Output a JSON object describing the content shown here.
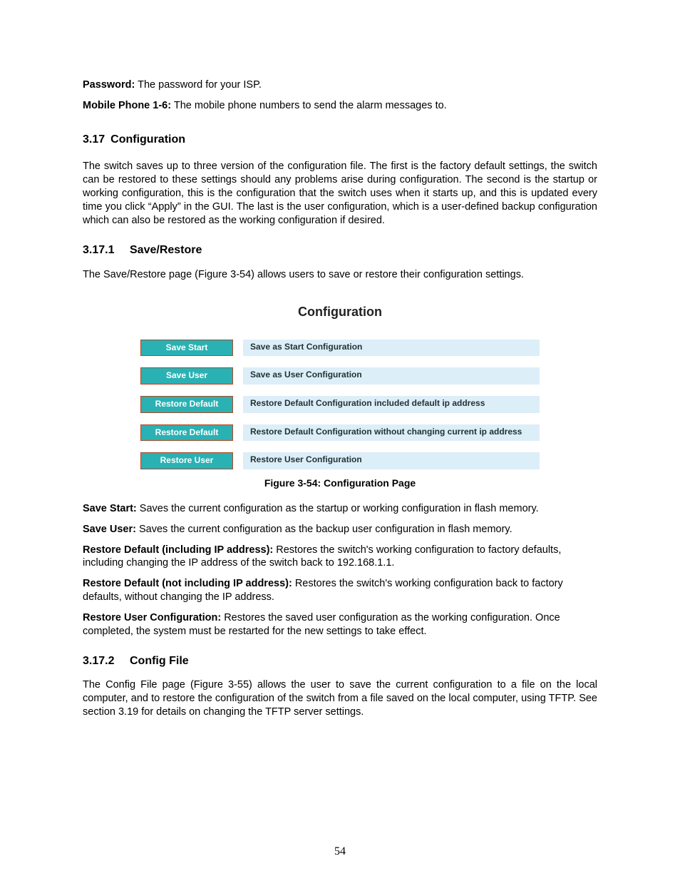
{
  "intro": {
    "password_label": "Password:",
    "password_text": " The password for your ISP.",
    "mobile_label": "Mobile Phone 1-6:",
    "mobile_text": " The mobile phone numbers to send the alarm messages to."
  },
  "sec317": {
    "num": "3.17",
    "title": "Configuration",
    "body": "The switch saves up to three version of the configuration file. The first is the factory default settings, the switch can be restored to these settings should any problems arise during configuration. The second is the startup or working configuration, this is the configuration that the switch uses when it starts up, and this is updated every time you click “Apply” in the GUI. The last is the user configuration, which is a user-defined backup configuration which can also be restored as the working configuration if desired."
  },
  "sec3171": {
    "num": "3.17.1",
    "title": "Save/Restore",
    "body": "The Save/Restore page (Figure 3-54) allows users to save or restore their configuration settings."
  },
  "screenshot": {
    "title": "Configuration",
    "rows": [
      {
        "button": "Save Start",
        "desc": "Save as Start Configuration"
      },
      {
        "button": "Save User",
        "desc": "Save as User Configuration"
      },
      {
        "button": "Restore Default",
        "desc": "Restore Default Configuration included default ip address"
      },
      {
        "button": "Restore Default",
        "desc": "Restore Default Configuration without changing current ip address"
      },
      {
        "button": "Restore User",
        "desc": "Restore User Configuration"
      }
    ],
    "caption": "Figure 3-54: Configuration Page"
  },
  "defs": {
    "savestart_label": "Save Start:",
    "savestart_text": " Saves the current configuration as the startup or working configuration in flash memory.",
    "saveuser_label": "Save User:",
    "saveuser_text": " Saves the current configuration as the backup user configuration in flash memory.",
    "restdef1_label": "Restore Default (including IP address):",
    "restdef1_text": " Restores the switch's working configuration to factory defaults, including changing the IP address of the switch back to 192.168.1.1.",
    "restdef2_label": "Restore Default (not including IP address):",
    "restdef2_text": " Restores the switch's working configuration back to factory defaults, without changing the IP address.",
    "restuser_label": "Restore User Configuration:",
    "restuser_text": " Restores the saved user configuration as the working configuration. Once completed, the system must be restarted for the new settings to take effect."
  },
  "sec3172": {
    "num": "3.17.2",
    "title": "Config File",
    "body": "The Config File page (Figure 3-55) allows the user to save the current configuration to a file on the local computer, and to restore the configuration of the switch from a file saved on the local computer, using TFTP. See section 3.19 for details on changing the TFTP server settings."
  },
  "page_number": "54"
}
